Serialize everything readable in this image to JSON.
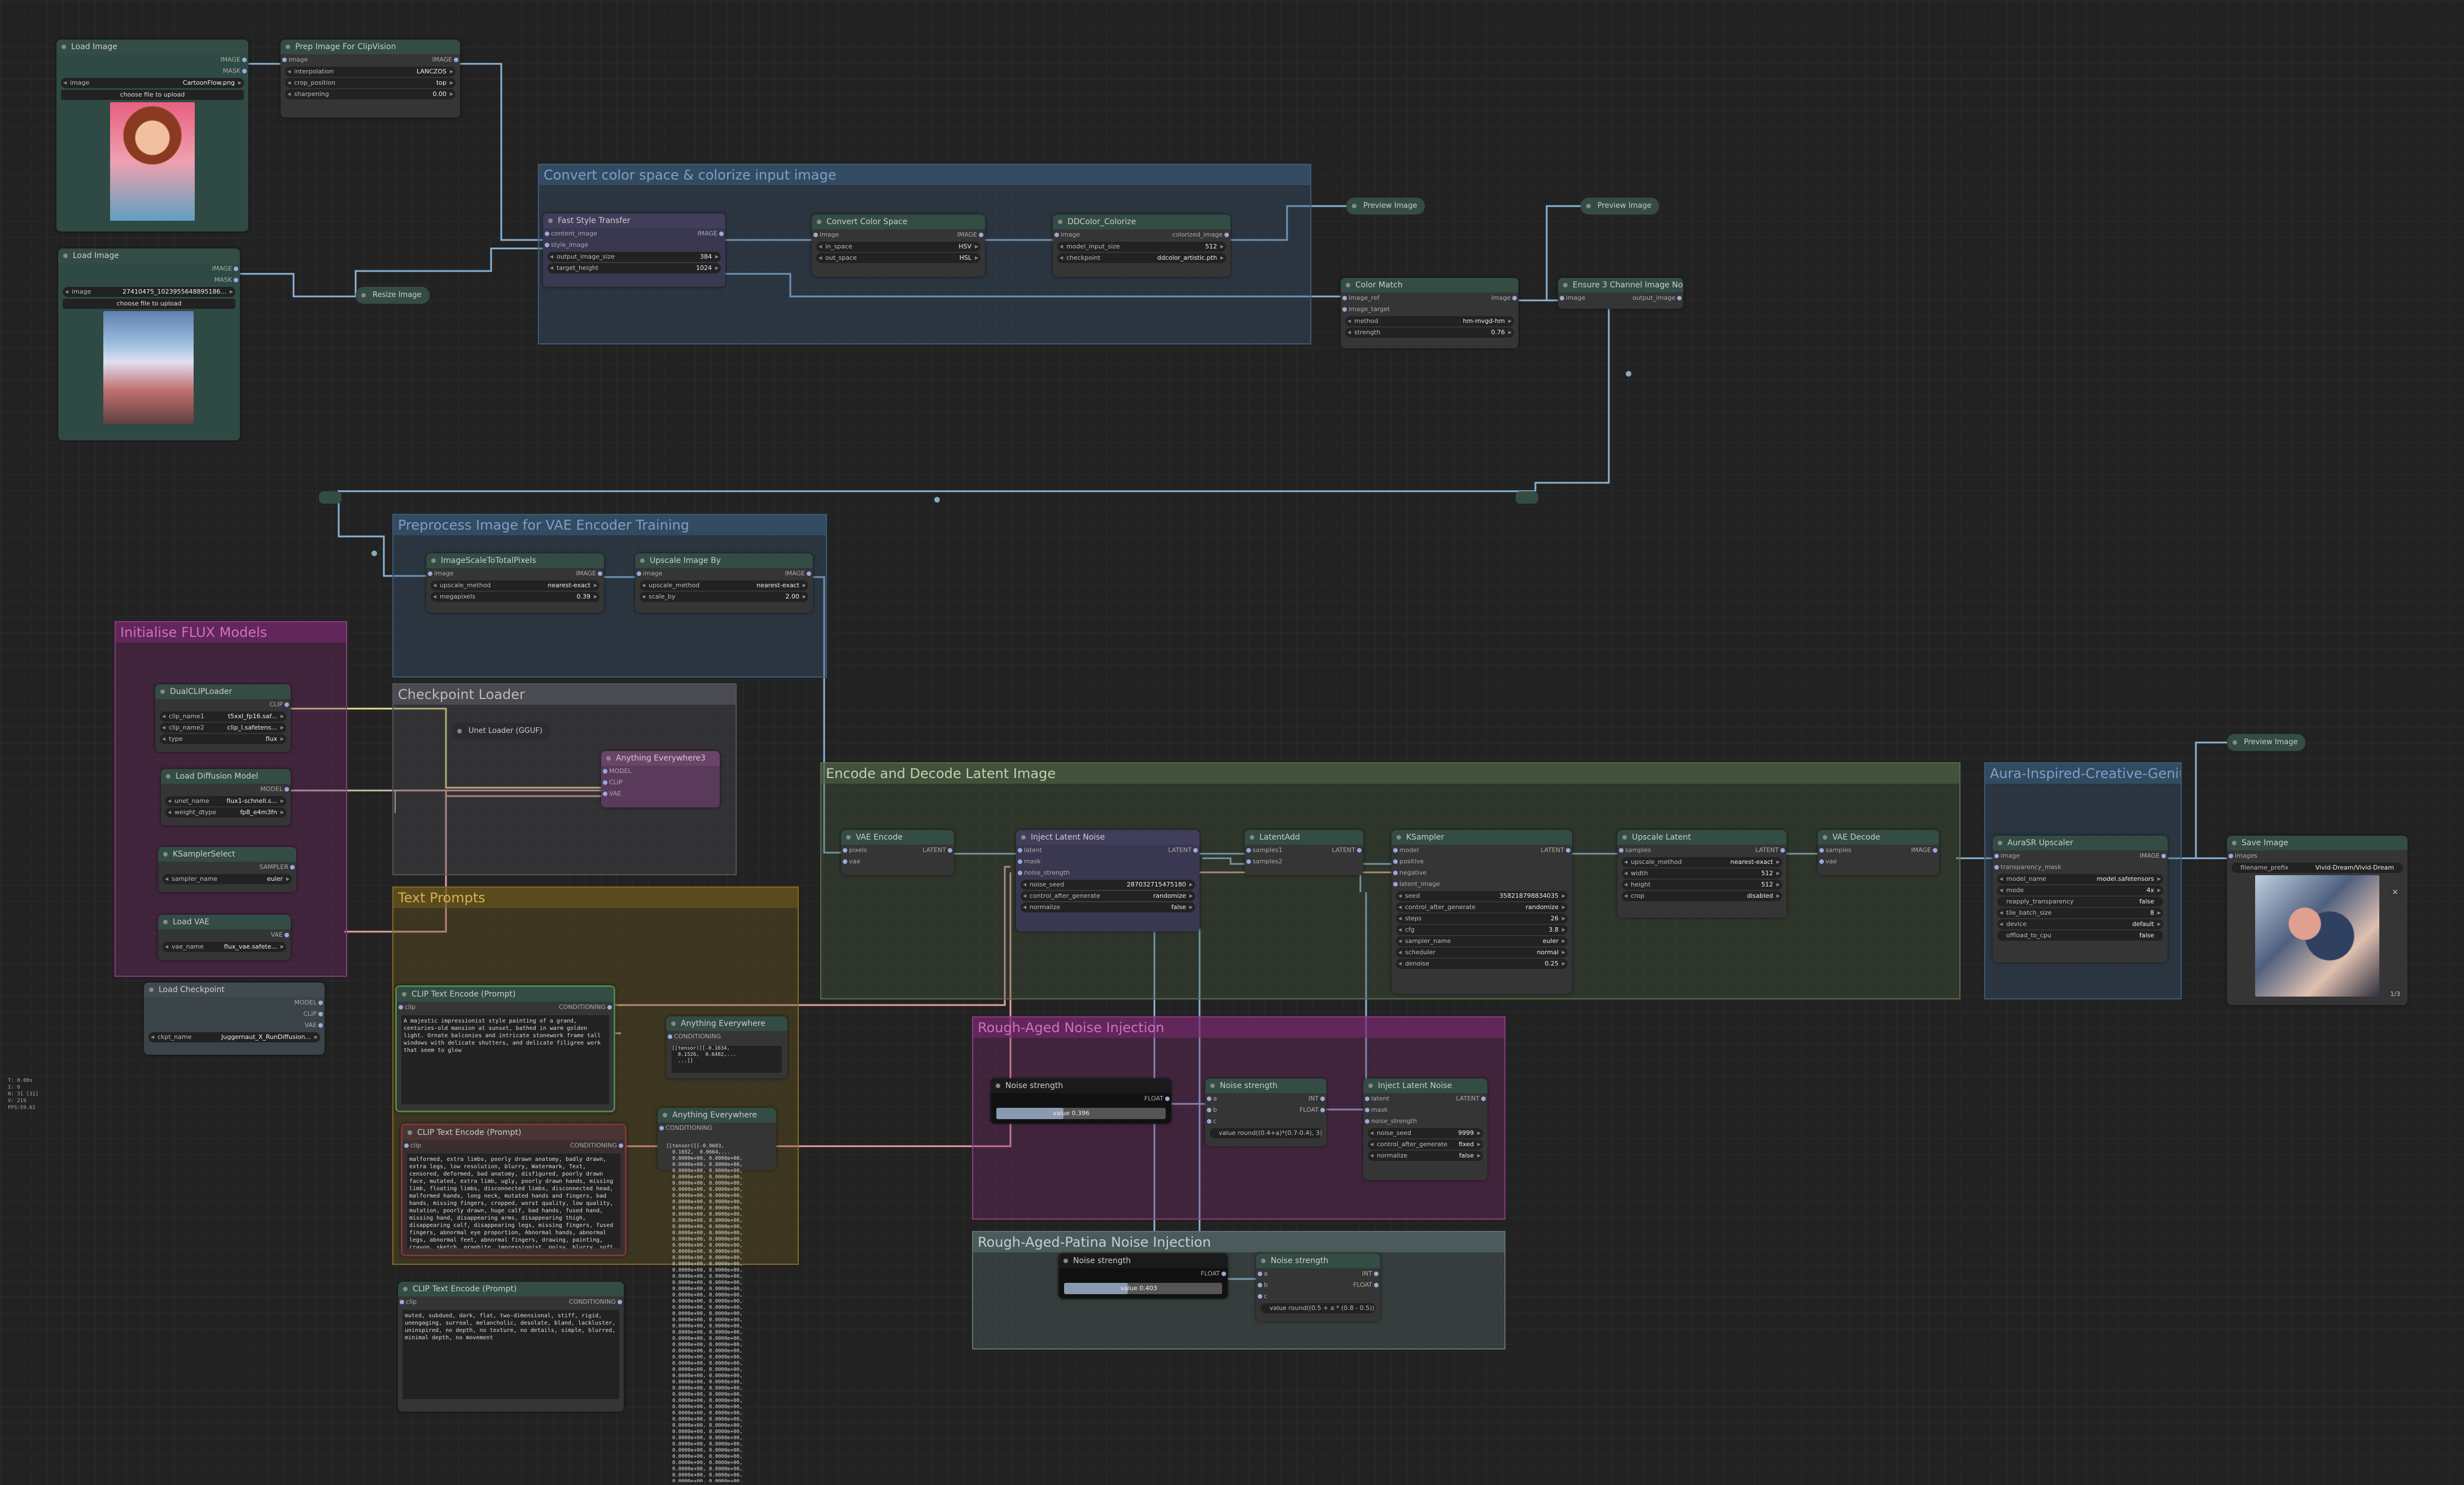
{
  "groups": {
    "convert": "Convert color space & colorize  input image",
    "preprocess": "Preprocess Image for VAE Encoder Training",
    "flux": "Initialise FLUX Models",
    "checkpoint": "Checkpoint Loader",
    "prompts": "Text Prompts",
    "encode": "Encode and Decode Latent Image",
    "aura": "Aura-Inspired-Creative-Genius",
    "rough": "Rough-Aged Noise Injection",
    "patina": "Rough-Aged-Patina Noise Injection"
  },
  "nodes": {
    "load1": {
      "title": "Load Image",
      "out1": "IMAGE",
      "out2": "MASK",
      "image_label": "image",
      "image_value": "CartoonFlow.png",
      "upload": "choose file to upload"
    },
    "prep": {
      "title": "Prep Image For ClipVision",
      "in": "image",
      "out": "IMAGE",
      "w1": "interpolation",
      "v1": "LANCZOS",
      "w2": "crop_position",
      "v2": "top",
      "w3": "sharpening",
      "v3": "0.00"
    },
    "load2": {
      "title": "Load Image",
      "out1": "IMAGE",
      "out2": "MASK",
      "image_label": "image",
      "image_value": "27410475_1023955648895186...",
      "upload": "choose file to upload"
    },
    "resize": "Resize Image",
    "fst": {
      "title": "Fast Style Transfer",
      "in1": "content_image",
      "in2": "style_image",
      "out": "IMAGE",
      "w1": "output_image_size",
      "v1": "384",
      "w2": "target_height",
      "v2": "1024"
    },
    "ccs": {
      "title": "Convert Color Space",
      "in": "image",
      "out": "IMAGE",
      "w1": "in_space",
      "v1": "HSV",
      "w2": "out_space",
      "v2": "HSL"
    },
    "ddc": {
      "title": "DDColor_Colorize",
      "in": "image",
      "out": "colorized_image",
      "w1": "model_input_size",
      "v1": "512",
      "w2": "checkpoint",
      "v2": "ddcolor_artistic.pth"
    },
    "preview1": "Preview Image",
    "preview2": "Preview Image",
    "preview3": "Preview Image",
    "cm": {
      "title": "Color Match",
      "in1": "image_ref",
      "in2": "image_target",
      "out": "image",
      "w1": "method",
      "v1": "hm-mvgd-hm",
      "w2": "strength",
      "v2": "0.76"
    },
    "e3c": {
      "title": "Ensure 3 Channel Image Node",
      "in": "image",
      "out": "output_image"
    },
    "isp": {
      "title": "ImageScaleToTotalPixels",
      "in": "image",
      "out": "IMAGE",
      "w1": "upscale_method",
      "v1": "nearest-exact",
      "w2": "megapixels",
      "v2": "0.39"
    },
    "uib": {
      "title": "Upscale Image By",
      "in": "image",
      "out": "IMAGE",
      "w1": "upscale_method",
      "v1": "nearest-exact",
      "w2": "scale_by",
      "v2": "2.00"
    },
    "dcl": {
      "title": "DualCLIPLoader",
      "out": "CLIP",
      "w1": "clip_name1",
      "v1": "t5xxl_fp16.saf...",
      "w2": "clip_name2",
      "v2": "clip_l.safetens...",
      "w3": "type",
      "v3": "flux"
    },
    "ldm": {
      "title": "Load Diffusion Model",
      "out": "MODEL",
      "w1": "unet_name",
      "v1": "flux1-schnell.s...",
      "w2": "weight_dtype",
      "v2": "fp8_e4m3fn"
    },
    "kss": {
      "title": "KSamplerSelect",
      "out": "SAMPLER",
      "w1": "sampler_name",
      "v1": "euler"
    },
    "lvae": {
      "title": "Load VAE",
      "out": "VAE",
      "w1": "vae_name",
      "v1": "flux_vae.safete..."
    },
    "lck": {
      "title": "Load Checkpoint",
      "out1": "MODEL",
      "out2": "CLIP",
      "out3": "VAE",
      "w1": "ckpt_name",
      "v1": "Juggernaut_X_RunDiffusion..."
    },
    "unet": "Unet Loader (GGUF)",
    "ae3": {
      "title": "Anything Everywhere3",
      "in1": "MODEL",
      "in2": "CLIP",
      "in3": "VAE"
    },
    "clip1": {
      "title": "CLIP Text Encode (Prompt)",
      "in": "clip",
      "out": "CONDITIONING",
      "text": "A majestic impressionist style painting of a grand, centuries-old mansion at sunset, bathed in warm golden light. Ornate balconies and intricate stonework frame tall windows with delicate shutters, and delicate filigree work that seem to glow"
    },
    "ae1": {
      "title": "Anything Everywhere",
      "in": "CONDITIONING"
    },
    "ae2": {
      "title": "Anything Everywhere",
      "in": "CONDITIONING"
    },
    "clip2": {
      "title": "CLIP Text Encode (Prompt)",
      "in": "clip",
      "out": "CONDITIONING",
      "text": "malformed, extra limbs, poorly drawn anatomy, badly drawn, extra legs, low resolution, blurry, Watermark, Text, censored, deformed, bad anatomy, disfigured, poorly drawn face, mutated, extra limb, ugly, poorly drawn hands, missing limb, floating limbs, disconnected limbs, disconnected head, malformed hands, long neck, mutated hands and fingers, bad hands, missing fingers, cropped, worst quality, low quality, mutation, poorly drawn, huge calf, bad hands, fused hand, missing hand, disappearing arms, disappearing thigh, disappearing calf, disappearing legs, missing fingers, fused fingers, abnormal eye proportion, Abnormal hands, abnormal legs, abnormal feet, abnormal fingers, drawing, painting, crayon, sketch, graphite, impressionist, noisy, blurry, soft, deformed, ugly"
    },
    "clip3": {
      "title": "CLIP Text Encode (Prompt)",
      "in": "clip",
      "out": "CONDITIONING",
      "text": "muted, subdued, dark, flat, two-dimensional, stiff, rigid, unengaging, surreal, melancholic, desolate, bland, lackluster, uninspired, no depth, no texture, no details, simple, blurred, minimal depth, no movement"
    },
    "vaeenc": {
      "title": "VAE Encode",
      "in1": "pixels",
      "in2": "vae",
      "out": "LATENT"
    },
    "iln1": {
      "title": "Inject Latent Noise",
      "in1": "latent",
      "in2": "mask",
      "in3": "noise_strength",
      "out": "LATENT",
      "w1": "noise_seed",
      "v1": "287032715475180",
      "w2": "control_after_generate",
      "v2": "randomize",
      "w3": "normalize",
      "v3": "false"
    },
    "ladd": {
      "title": "LatentAdd",
      "in1": "samples1",
      "in2": "samples2",
      "out": "LATENT"
    },
    "ks": {
      "title": "KSampler",
      "in1": "model",
      "in2": "positive",
      "in3": "negative",
      "in4": "latent_image",
      "out": "LATENT",
      "w1": "seed",
      "v1": "358218798834035",
      "w2": "control_after_generate",
      "v2": "randomize",
      "w3": "steps",
      "v3": "26",
      "w4": "cfg",
      "v4": "3.8",
      "w5": "sampler_name",
      "v5": "euler",
      "w6": "scheduler",
      "v6": "normal",
      "w7": "denoise",
      "v7": "0.25"
    },
    "ul": {
      "title": "Upscale Latent",
      "in": "samples",
      "out": "LATENT",
      "w1": "upscale_method",
      "v1": "nearest-exact",
      "w2": "width",
      "v2": "512",
      "w3": "height",
      "v3": "512",
      "w4": "crop",
      "v4": "disabled"
    },
    "vaedec": {
      "title": "VAE Decode",
      "in1": "samples",
      "in2": "vae",
      "out": "IMAGE"
    },
    "aura": {
      "title": "AuraSR Upscaler",
      "in1": "image",
      "in2": "transparency_mask",
      "out": "IMAGE",
      "w1": "model_name",
      "v1": "model.safetensors",
      "w2": "mode",
      "v2": "4x",
      "w3": "reapply_transparency",
      "v3": "false",
      "w4": "tile_batch_size",
      "v4": "8",
      "w5": "device",
      "v5": "default",
      "w6": "offload_to_cpu",
      "v6": "false"
    },
    "save": {
      "title": "Save Image",
      "in": "images",
      "w1": "filename_prefix",
      "v1": "Vivid-Dream/Vivid-Dream",
      "counter": "1/3"
    },
    "ns1": {
      "title": "Noise strength",
      "out": "FLOAT",
      "label": "value 0.396",
      "value": 0.396
    },
    "ns2": {
      "title": "Noise strength",
      "in1": "a",
      "in2": "b",
      "in3": "c",
      "out1": "INT",
      "out2": "FLOAT",
      "expr": "value round((0.4+a)*(0.7-0.4), 3)"
    },
    "iln2": {
      "title": "Inject Latent Noise",
      "in1": "latent",
      "in2": "mask",
      "in3": "noise_strength",
      "out": "LATENT",
      "w1": "noise_seed",
      "v1": "9999",
      "w2": "control_after_generate",
      "v2": "fixed",
      "w3": "normalize",
      "v3": "false"
    },
    "ns3": {
      "title": "Noise strength",
      "out": "FLOAT",
      "label": "value 0.403",
      "value": 0.403
    },
    "ns4": {
      "title": "Noise strength",
      "in1": "a",
      "in2": "b",
      "in3": "c",
      "out1": "INT",
      "out2": "FLOAT",
      "expr": "value round((0.5 + a * (0.8 - 0.5)))"
    }
  },
  "dumps": {
    "d1": "[[tensor([[-0.1634,\n  0.1526,  0.6482,...\n  ...]]",
    "d2": "[[tensor([[-0.9603,\n  0.1652,  0.0664,...\n  0.0000e+00, 0.0000e+00,\n  0.0000e+00, 0.0000e+00,\n  0.0000e+00, 0.0000e+00,\n  0.0000e+00, 0.0000e+00,\n  0.0000e+00, 0.0000e+00,\n  0.0000e+00, 0.0000e+00,\n  0.0000e+00, 0.0000e+00,\n  0.0000e+00, 0.0000e+00,\n  0.0000e+00, 0.0000e+00,\n  0.0000e+00, 0.0000e+00,\n  0.0000e+00, 0.0000e+00,\n  0.0000e+00, 0.0000e+00,\n  0.0000e+00, 0.0000e+00,\n  0.0000e+00, 0.0000e+00,\n  0.0000e+00, 0.0000e+00,\n  0.0000e+00, 0.0000e+00,\n  0.0000e+00, 0.0000e+00,\n  0.0000e+00, 0.0000e+00,\n  0.0000e+00, 0.0000e+00,\n  0.0000e+00, 0.0000e+00,\n  0.0000e+00, 0.0000e+00,\n  0.0000e+00, 0.0000e+00,\n  0.0000e+00, 0.0000e+00,\n  0.0000e+00, 0.0000e+00,\n  0.0000e+00, 0.0000e+00,\n  0.0000e+00, 0.0000e+00,\n  0.0000e+00, 0.0000e+00,\n  0.0000e+00, 0.0000e+00,\n  0.0000e+00, 0.0000e+00,\n  0.0000e+00, 0.0000e+00,\n  0.0000e+00, 0.0000e+00,\n  0.0000e+00, 0.0000e+00,\n  0.0000e+00, 0.0000e+00,\n  0.0000e+00, 0.0000e+00,\n  0.0000e+00, 0.0000e+00,\n  0.0000e+00, 0.0000e+00,\n  0.0000e+00, 0.0000e+00,\n  0.0000e+00, 0.0000e+00,\n  0.0000e+00, 0.0000e+00,\n  0.0000e+00, 0.0000e+00,\n  0.0000e+00, 0.0000e+00,\n  0.0000e+00, 0.0000e+00,\n  0.0000e+00, 0.0000e+00,\n  0.0000e+00, 0.0000e+00,\n  0.0000e+00, 0.0000e+00,\n  0.0000e+00, 0.0000e+00,\n  0.0000e+00, 0.0000e+00,\n  0.0000e+00, 0.0000e+00,\n  0.0000e+00, 0.0000e+00,\n  0.0000e+00, 0.0000e+00,\n  0.0000e+00, 0.0000e+00,\n  0.0000e+00, 0.0000e+00,\n  0.0000e+00, 0.0000e+00,\n  0.0000e+00, 0.0000e+00,\n  0.0000e+00, 0.0000e+00,\n  0.0000e+00, 0.0000e+00,\n  0.0000e+00, 0.0000e+00,\n  0.0000e+00, 0.0000e+00,\n  0.0000e+00, 0.0000e+00,\n  0.0000e+00, 0.0000e+00,\n  0.0000e+00, 0.0000e+00,\n  0.0000e+00, 0.0000e+00,\n  0.0000e+00, 0.0000e+00,\n  0.0000e+00, 0.0000e+00,\n  0.0000e+00, 0.0000e+00,\n  0.0000e+00, 0.0000e+00,\n  0.0000e+00, 0.0000e+00,\n  0.0000e+00, 0.0000e+00,\n  0.0000e+00, 0.0000e+00,\n  0.0000e+00, 0.0000e+00,\n  0.0000e+00, 0.0000e+00,\n  0.0000e+00, 0.0000e+00,\n  0.0000e+00, 0.0000e+00,\n  0.0000e+00, 0.0000e+00,\n  0.0000e+00, 0.0000e+00,\n  0.0000e+00, 0.0000e+00,\n  0.0000e+00, 0.0000e+00,\n  0.0000e+00, 0.0000e+00,\n  0.0000e+00, 0.0000e+00,\n  0.0000e+00, 0.0000e+00,\n  0.0000e+00, 0.0000e+00,\n  0.0000e+00, 0.0000e+00,\n  0.0000e+00, 0.0000e+00,\n  0.0000e+00, 0.0000e+00,\n  0.0000e+00, 0.0000e+00,\n  0.0000e+00, 0.0000e+00,\n  0.0000e+00, 0.0000e+00,\n  0.0000e+00, 0.0000e+00,\n  0.0000e+00, 0.0000e+00,\n  0.0000e+00, 0.0000e+00,\n  0.0000e+00, 0.0000e+00,\n  0.0000e+00, 0.0000e+00,\n  0.0000e+00, 0.0000e+00,\n  0.0000e+00, 0.0000e+00,\n  0.0000e+00, 0.0000e+00,\n  0.0000e+00, 0.0000e+00,\n  0.0000e+00, 0.0000e+00,\n  0.0000e+00, 0.0000e+00,\n  0.0000e+00, 0.0000e+00,\n  0.0000e+00, 0.0000e+00,\n  0.0000e+00, 0.0000e+00,\n  0.0000e+00, 0.0000e+00,\n  0.0000e+00, 0.0000e+00,\n  0.0000e+00, 0.0000e+00,\n  0.0000e+00, 0.0000e+00,\n  0.0000e+00, 0.0000e+00,\n  0.0000e+00, 0.0000e+00,\n  0.0000e+00, 0.0000e+00,\n  0.0000e+00, 0.0000e+00,\n  0.0000e+00, 0.0000e+00,\n  0.0000e+00, 0.0000e+00,\n  0.0000e+00, 0.0000e+00,\n  0.0000e+00, 0.0000e+00,\n  0.0000e+00, 0.0000e+00,\n  0.0000e+00, 0.0000e+00,\n  0.0000e+00, 0.0000e+00,\n  0.0000e+00, 0.0000e+00,\n  -0.1227e-01]])]]"
  },
  "hud": "T: 0.00s\nI: 0\nN: 31 [31]\nV: 219\nFPS:59.61",
  "colors": {
    "link_blue": "#8ab4d8",
    "link_pink": "#e8a0a0",
    "link_yellow": "#e8e090",
    "node_green": "#2f4a44",
    "group_blue": "#3a5a78",
    "group_pink": "#8a3a80",
    "group_olive": "#5a6a4a"
  }
}
